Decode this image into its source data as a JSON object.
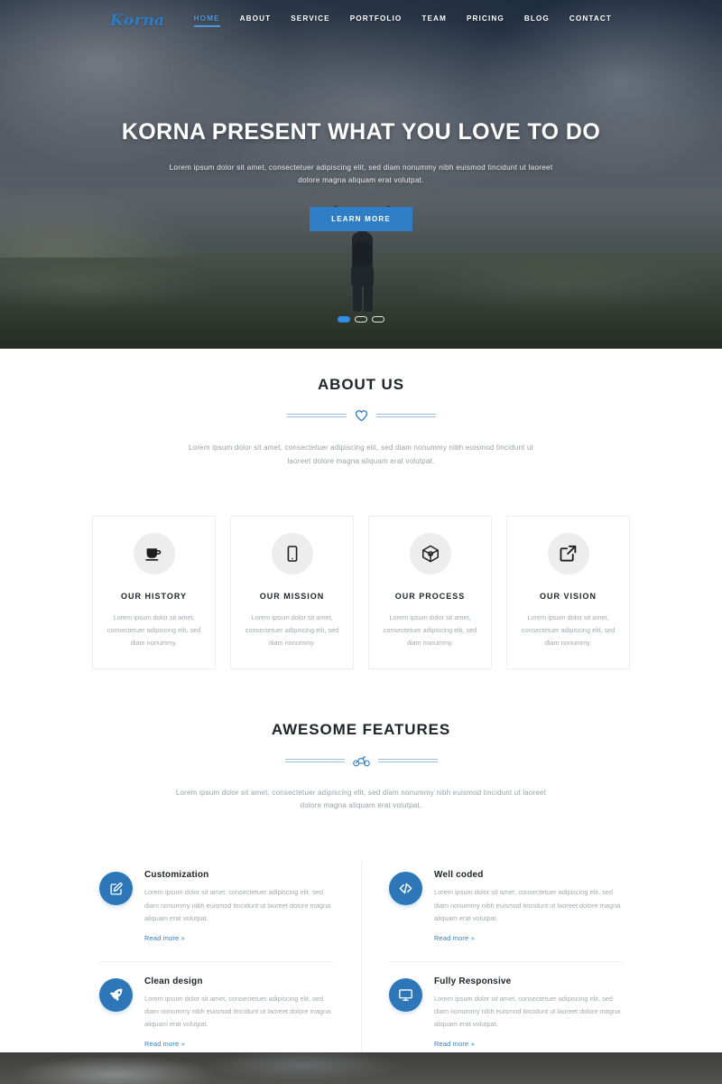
{
  "brand": {
    "logo_text": "Korna",
    "accent_color": "#2f7dc4"
  },
  "nav": {
    "items": [
      {
        "label": "HOME",
        "active": true
      },
      {
        "label": "ABOUT",
        "active": false
      },
      {
        "label": "SERVICE",
        "active": false
      },
      {
        "label": "PORTFOLIO",
        "active": false
      },
      {
        "label": "TEAM",
        "active": false
      },
      {
        "label": "PRICING",
        "active": false
      },
      {
        "label": "BLOG",
        "active": false
      },
      {
        "label": "CONTACT",
        "active": false
      }
    ]
  },
  "hero": {
    "title": "KORNA PRESENT WHAT YOU LOVE TO DO",
    "subtitle": "Lorem ipsum dolor sit amet, consectetuer adipiscing elit, sed diam nonummy nibh euismod tincidunt ut laoreet dolore magna aliquam erat volutpat.",
    "cta_label": "LEARN MORE",
    "slide_count": 3,
    "active_slide": 1
  },
  "about": {
    "title": "ABOUT US",
    "divider_icon": "heart-icon",
    "lead": "Lorem ipsum dolor sit amet, consectetuer adipiscing elit, sed diam nonummy nibh euismod tincidunt ut laoreet dolore magna aliquam erat volutpat.",
    "cards": [
      {
        "icon": "coffee-cup-icon",
        "title": "OUR HISTORY",
        "text": "Lorem ipsum dolor sit amet, consectetuer adipiscing elit, sed diam nonummy."
      },
      {
        "icon": "tablet-icon",
        "title": "OUR MISSION",
        "text": "Lorem ipsum dolor sit amet, consectetuer adipiscing elit, sed diam nonummy."
      },
      {
        "icon": "cube-icon",
        "title": "OUR PROCESS",
        "text": "Lorem ipsum dolor sit amet, consectetuer adipiscing elit, sed diam nonummy."
      },
      {
        "icon": "external-link-icon",
        "title": "OUR VISION",
        "text": "Lorem ipsum dolor sit amet, consectetuer adipiscing elit, sed diam nonummy."
      }
    ]
  },
  "features": {
    "title": "AWESOME FEATURES",
    "divider_icon": "bicycle-icon",
    "lead": "Lorem ipsum dolor sit amet, consectetuer adipiscing elit, sed diam nonummy nibh euismod tincidunt ut laoreet dolore magna aliquam erat volutpat.",
    "read_more_label": "Read more »",
    "items": [
      {
        "icon": "edit-square-icon",
        "title": "Customization",
        "text": "Lorem ipsum dolor sit amet, consectetuer adipiscing elit, sed diam nonummy nibh euismod tincidunt ut laoreet dolore magna aliquam erat volutpat."
      },
      {
        "icon": "code-icon",
        "title": "Well coded",
        "text": "Lorem ipsum dolor sit amet, consectetuer adipiscing elit, sed diam nonummy nibh euismod tincidunt ut laoreet dolore magna aliquam erat volutpat."
      },
      {
        "icon": "rocket-icon",
        "title": "Clean design",
        "text": "Lorem ipsum dolor sit amet, consectetuer adipiscing elit, sed diam nonummy nibh euismod tincidunt ut laoreet dolore magna aliquam erat volutpat."
      },
      {
        "icon": "monitor-icon",
        "title": "Fully Responsive",
        "text": "Lorem ipsum dolor sit amet, consectetuer adipiscing elit, sed diam nonummy nibh euismod tincidunt ut laoreet dolore magna aliquam erat volutpat."
      }
    ]
  }
}
